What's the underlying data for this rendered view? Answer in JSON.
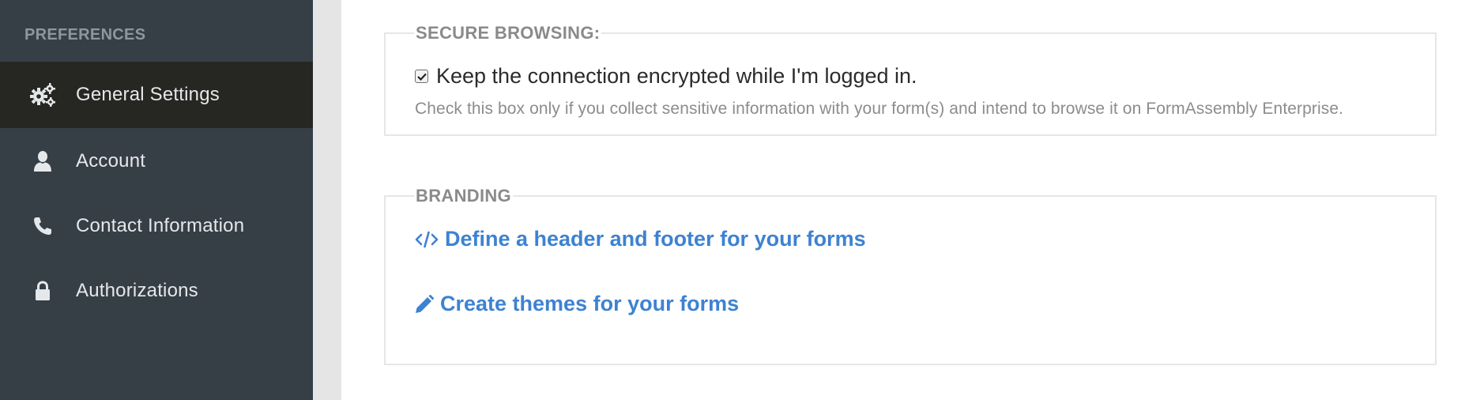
{
  "sidebar": {
    "heading": "PREFERENCES",
    "items": [
      {
        "label": "General Settings",
        "icon": "gears-icon",
        "active": true
      },
      {
        "label": "Account",
        "icon": "user-icon",
        "active": false
      },
      {
        "label": "Contact Information",
        "icon": "phone-icon",
        "active": false
      },
      {
        "label": "Authorizations",
        "icon": "lock-icon",
        "active": false
      }
    ]
  },
  "secure_browsing": {
    "legend": "SECURE BROWSING:",
    "checkbox_label": "Keep the connection encrypted while I'm logged in.",
    "checked": true,
    "help_text": "Check this box only if you collect sensitive information with your form(s) and intend to browse it on FormAssembly Enterprise."
  },
  "branding": {
    "legend": "BRANDING",
    "links": [
      {
        "label": "Define a header and footer for your forms",
        "icon": "code-icon"
      },
      {
        "label": "Create themes for your forms",
        "icon": "pencil-icon"
      }
    ]
  },
  "colors": {
    "sidebar_bg": "#363e46",
    "sidebar_active_bg": "#262722",
    "link": "#3d82d2"
  }
}
